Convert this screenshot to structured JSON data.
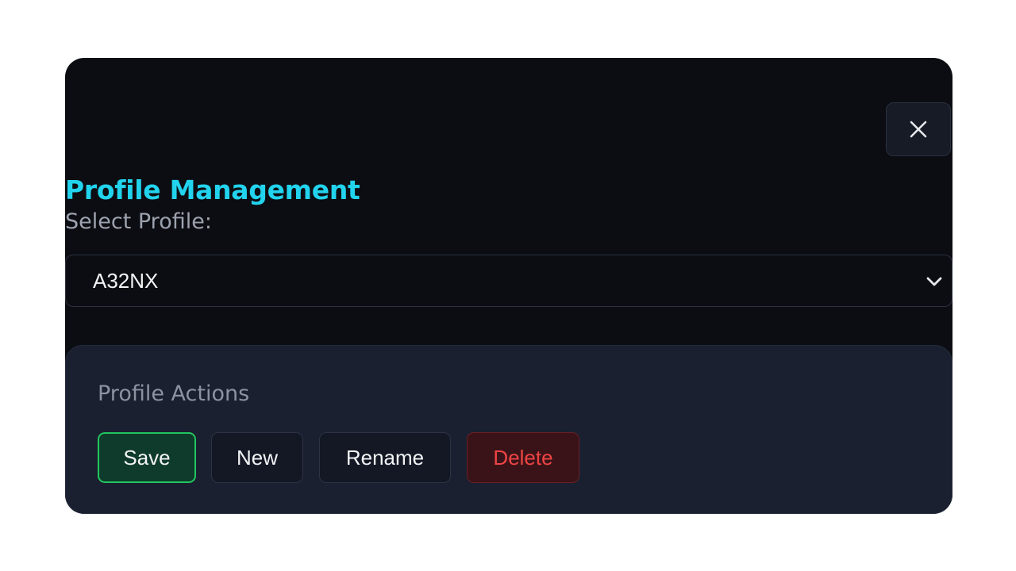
{
  "dialog": {
    "title": "Profile Management",
    "close_icon": "close-icon"
  },
  "profile_select": {
    "label": "Select Profile:",
    "selected_value": "A32NX",
    "chevron_icon": "chevron-down-icon"
  },
  "profile_actions": {
    "title": "Profile Actions",
    "save_label": "Save",
    "new_label": "New",
    "rename_label": "Rename",
    "delete_label": "Delete"
  },
  "colors": {
    "accent": "#22d3ee",
    "dialog_bg": "#0c0d12",
    "panel_bg": "#1a2030",
    "save_border": "#22c55e",
    "delete_text": "#ef4444"
  }
}
